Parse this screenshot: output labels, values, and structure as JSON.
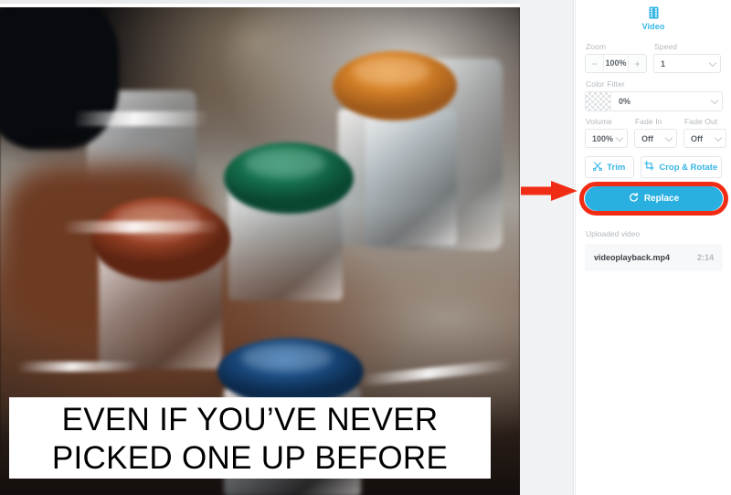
{
  "app": {
    "accent_blue": "#2ab0e0",
    "annotation_red": "#f12c14",
    "panel_label_gray": "#b2b8bd"
  },
  "video_preview": {
    "name": "video-preview",
    "caption_line_1": "EVEN IF YOU’VE NEVER",
    "caption_line_2": "PICKED ONE UP BEFORE",
    "scene_colors": {
      "cap_orange": "#d98428",
      "cap_teal": "#15734f",
      "cap_red": "#9c4226",
      "cap_blue": "#1a4c82"
    }
  },
  "panel": {
    "tab": {
      "label": "Video",
      "icon": "film-strip-icon"
    },
    "zoom": {
      "label": "Zoom",
      "value": "100%",
      "minus": "−",
      "plus": "+"
    },
    "speed": {
      "label": "Speed",
      "value": "1"
    },
    "color_filter": {
      "label": "Color Filter",
      "value": "0%"
    },
    "volume": {
      "label": "Volume",
      "value": "100%"
    },
    "fade_in": {
      "label": "Fade In",
      "value": "Off"
    },
    "fade_out": {
      "label": "Fade Out",
      "value": "Off"
    },
    "trim_button": {
      "label": "Trim",
      "icon": "scissors-icon"
    },
    "crop_rotate_button": {
      "label": "Crop & Rotate",
      "icon": "crop-icon"
    },
    "replace_button": {
      "label": "Replace",
      "icon": "refresh-icon",
      "highlighted": "true"
    },
    "uploaded": {
      "section_label": "Uploaded video",
      "file_name": "videoplayback.mp4",
      "duration": "2:14"
    }
  },
  "annotation": {
    "arrow": "red-arrow-pointing-right",
    "target": "replace-button"
  }
}
